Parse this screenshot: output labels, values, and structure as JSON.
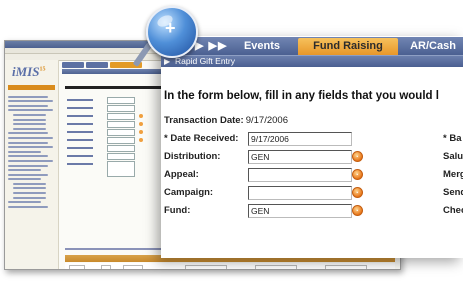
{
  "background_window": {
    "brand": "iMIS",
    "brand_version": "15"
  },
  "nav_arrows": "▶ ▶▶",
  "tabs": [
    {
      "label": "Events"
    },
    {
      "label": "Fund Raising",
      "active": true
    },
    {
      "label": "AR/Cash"
    }
  ],
  "subtitle": {
    "icon": "arrow-right-icon",
    "text": "Rapid Gift Entry"
  },
  "instruction": "In the form below, fill in any fields that you would l",
  "transaction_date": {
    "label": "Transaction Date:",
    "value": "9/17/2006"
  },
  "fields": [
    {
      "label": "* Date Received:",
      "value": "9/17/2006",
      "lookup": false,
      "right_label": "* Ba"
    },
    {
      "label": "Distribution:",
      "value": "GEN",
      "lookup": true,
      "right_label": "Salu"
    },
    {
      "label": "Appeal:",
      "value": "",
      "lookup": true,
      "right_label": "Merg"
    },
    {
      "label": "Campaign:",
      "value": "",
      "lookup": true,
      "right_label": "Send"
    },
    {
      "label": "Fund:",
      "value": "GEN",
      "lookup": true,
      "right_label": "Chec"
    }
  ],
  "colors": {
    "tab_active": "#e8972a",
    "bar_blue": "#4b6091",
    "lookup_orange": "#e8761a"
  }
}
